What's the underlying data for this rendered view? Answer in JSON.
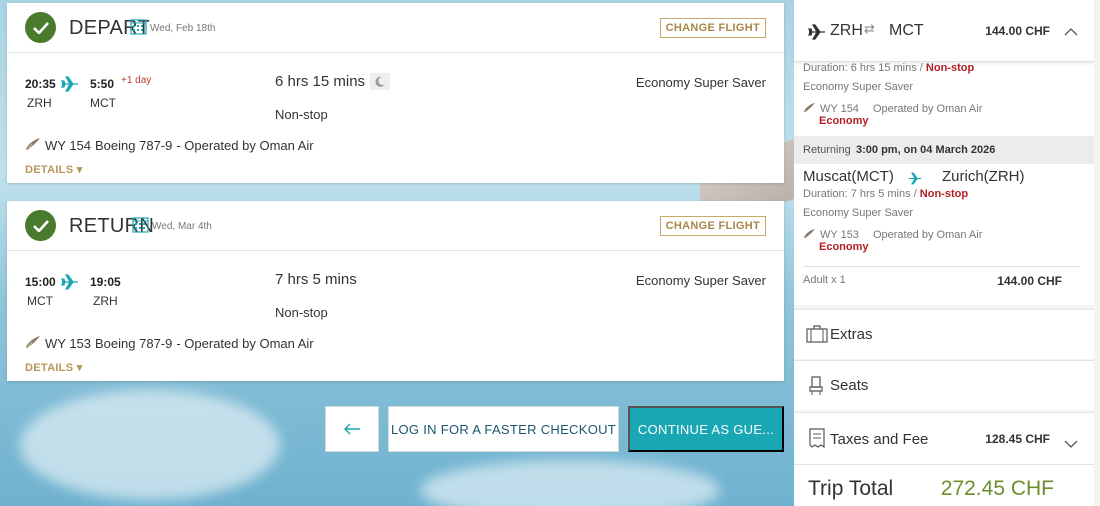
{
  "depart": {
    "title": "DEPART",
    "date": "Wed, Feb 18th",
    "change_label": "CHANGE FLIGHT",
    "dep_time": "20:35",
    "dep_code": "ZRH",
    "arr_time": "5:50",
    "arr_code": "MCT",
    "plus_day": "+1 day",
    "duration": "6 hrs 15 mins",
    "stops": "Non-stop",
    "cabin": "Economy Super Saver",
    "flight_no": "WY 154",
    "aircraft": "Boeing 787-9",
    "operated": "- Operated by Oman Air",
    "details_label": "DETAILS"
  },
  "return": {
    "title": "RETURN",
    "date": "Wed, Mar 4th",
    "change_label": "CHANGE FLIGHT",
    "dep_time": "15:00",
    "dep_code": "MCT",
    "arr_time": "19:05",
    "arr_code": "ZRH",
    "duration": "7 hrs 5 mins",
    "stops": "Non-stop",
    "cabin": "Economy Super Saver",
    "flight_no": "WY 153",
    "aircraft": "Boeing 787-9",
    "operated": "- Operated by Oman Air",
    "details_label": "DETAILS"
  },
  "actions": {
    "login_label": "LOG IN FOR A FASTER CHECKOUT",
    "guest_label": "CONTINUE AS GUE..."
  },
  "summary": {
    "from": "ZRH",
    "to": "MCT",
    "price": "144.00 CHF",
    "outbound_duration": "Duration: 6 hrs 15 mins /",
    "outbound_stop": "Non-stop",
    "outbound_cabin": "Economy Super Saver",
    "outbound_flight": "WY 154",
    "outbound_operated": "Operated by Oman Air",
    "outbound_class": "Economy",
    "returning_label": "Returning",
    "returning_when": "3:00 pm, on 04 March 2026",
    "return_from_city": "Muscat(MCT)",
    "return_to_city": "Zurich(ZRH)",
    "return_duration": "Duration: 7 hrs 5 mins /",
    "return_stop": "Non-stop",
    "return_cabin": "Economy Super Saver",
    "return_flight": "WY 153",
    "return_operated": "Operated by Oman Air",
    "return_class": "Economy",
    "adult_label": "Adult x 1",
    "adult_price": "144.00 CHF",
    "extras_label": "Extras",
    "seats_label": "Seats",
    "taxes_label": "Taxes and Fee",
    "taxes_price": "128.45 CHF",
    "total_label": "Trip Total",
    "total_price": "272.45 CHF"
  },
  "colors": {
    "accent_teal": "#1aa7b4",
    "check_green": "#4a7a2b",
    "gold": "#b8965a",
    "alert_red": "#b21f24",
    "total_green": "#6a8f2d"
  }
}
